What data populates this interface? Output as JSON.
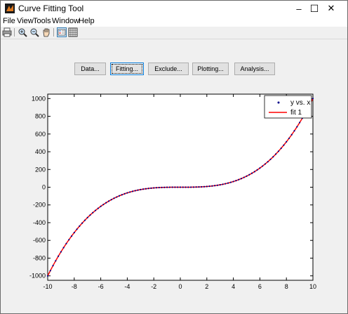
{
  "window": {
    "title": "Curve Fitting Tool",
    "controls": {
      "minimize": "–",
      "maximize": "☐",
      "close": "✕"
    }
  },
  "menu": [
    "File",
    "View",
    "Tools",
    "Window",
    "Help"
  ],
  "toolbar": [
    "print-icon",
    "zoom-in-icon",
    "zoom-out-icon",
    "pan-icon",
    "legend-toggle-icon",
    "grid-toggle-icon"
  ],
  "buttons": {
    "data": "Data...",
    "fitting": "Fitting...",
    "exclude": "Exclude...",
    "plotting": "Plotting...",
    "analysis": "Analysis..."
  },
  "chart_data": {
    "type": "scatter",
    "xlim": [
      -10,
      10
    ],
    "ylim": [
      -1050,
      1050
    ],
    "x_ticks": [
      -10,
      -8,
      -6,
      -4,
      -2,
      0,
      2,
      4,
      6,
      8,
      10
    ],
    "y_ticks": [
      -1000,
      -800,
      -600,
      -400,
      -200,
      0,
      200,
      400,
      600,
      800,
      1000
    ],
    "legend": {
      "position": "top-right",
      "entries": [
        "y vs. x",
        "fit 1"
      ]
    },
    "series": [
      {
        "name": "y vs. x",
        "kind": "points",
        "color": "#00008b",
        "x_start": -10,
        "x_end": 10,
        "x_step": 0.2,
        "model": "y = x^3"
      },
      {
        "name": "fit 1",
        "kind": "line",
        "color": "#ff0000",
        "model": "y = x^3"
      }
    ],
    "grid": false
  }
}
